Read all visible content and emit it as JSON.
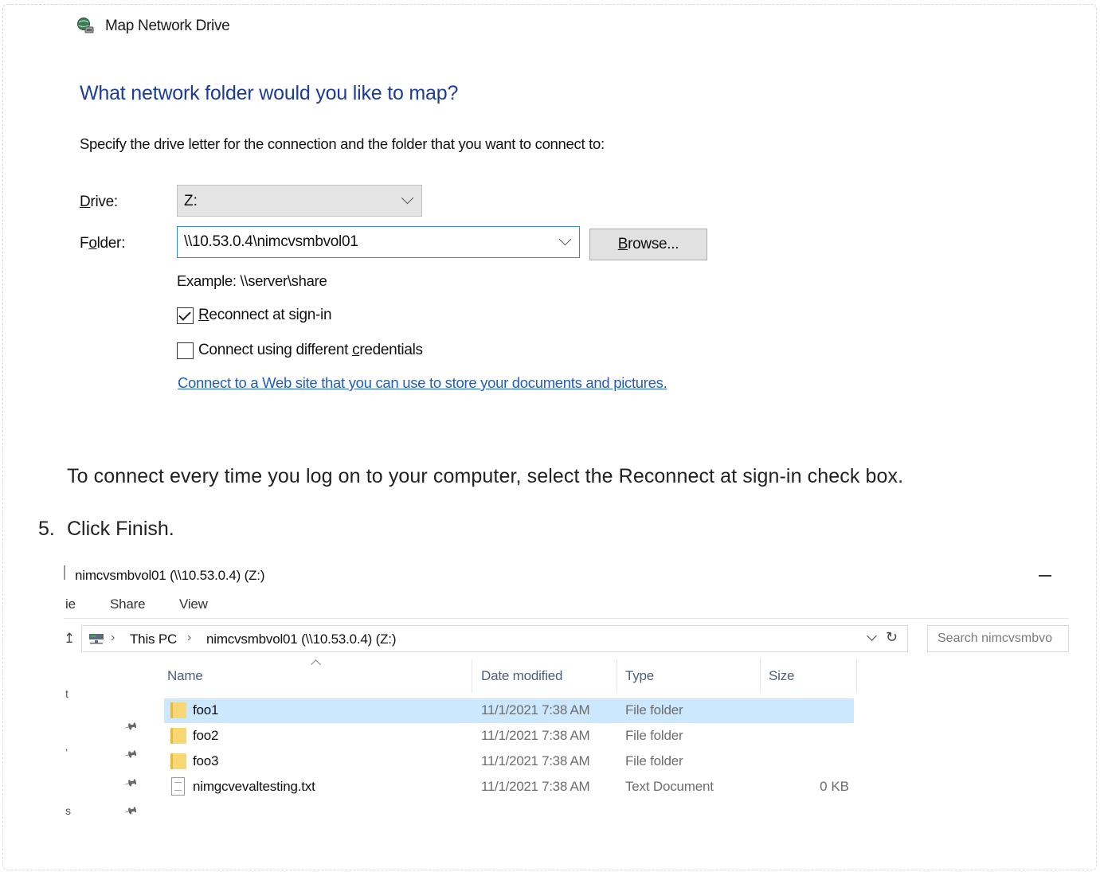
{
  "dialog": {
    "title": "Map Network Drive",
    "heading": "What network folder would you like to map?",
    "description": "Specify the drive letter for the connection and the folder that you want to connect to:",
    "drive_label_accel": "D",
    "drive_label_rest": "rive:",
    "drive_value": "Z:",
    "folder_label_pre": "F",
    "folder_label_accel": "o",
    "folder_label_rest": "lder:",
    "folder_value": "\\\\10.53.0.4\\nimcvsmbvol01",
    "browse_accel": "B",
    "browse_rest": "rowse...",
    "example": "Example: \\\\server\\share",
    "reconnect_accel": "R",
    "reconnect_rest": "econnect at sign-in",
    "reconnect_checked": true,
    "credentials_pre": "Connect using different ",
    "credentials_accel": "c",
    "credentials_rest": "redentials",
    "credentials_checked": false,
    "web_link": "Connect to a Web site that you can use to store your documents and pictures."
  },
  "doc": {
    "paragraph": "To connect every time you log on to your computer, select the Reconnect at sign-in check box.",
    "step_number": "5.",
    "step_text": "Click Finish."
  },
  "explorer": {
    "title": "nimcvsmbvol01 (\\\\10.53.0.4) (Z:)",
    "ribbon_tabs": [
      "ie",
      "Share",
      "View"
    ],
    "breadcrumb": [
      "This PC",
      "nimcvsmbvol01 (\\\\10.53.0.4) (Z:)"
    ],
    "search_placeholder": "Search nimcvsmbvo",
    "columns": [
      "Name",
      "Date modified",
      "Type",
      "Size"
    ],
    "files": [
      {
        "name": "foo1",
        "date": "11/1/2021 7:38 AM",
        "type": "File folder",
        "size": "",
        "icon": "folder-icon",
        "selected": true
      },
      {
        "name": "foo2",
        "date": "11/1/2021 7:38 AM",
        "type": "File folder",
        "size": "",
        "icon": "folder-icon",
        "selected": false
      },
      {
        "name": "foo3",
        "date": "11/1/2021 7:38 AM",
        "type": "File folder",
        "size": "",
        "icon": "folder-icon",
        "selected": false
      },
      {
        "name": "nimgcvevaltesting.txt",
        "date": "11/1/2021 7:38 AM",
        "type": "Text Document",
        "size": "0 KB",
        "icon": "text-file-icon",
        "selected": false
      }
    ],
    "side_fragments": [
      "t",
      "’",
      "s"
    ]
  },
  "colors": {
    "heading_blue": "#1c3c9a",
    "link_blue": "#1f5fc4",
    "selection": "#cce8ff",
    "focus_border": "#3c84d6"
  }
}
